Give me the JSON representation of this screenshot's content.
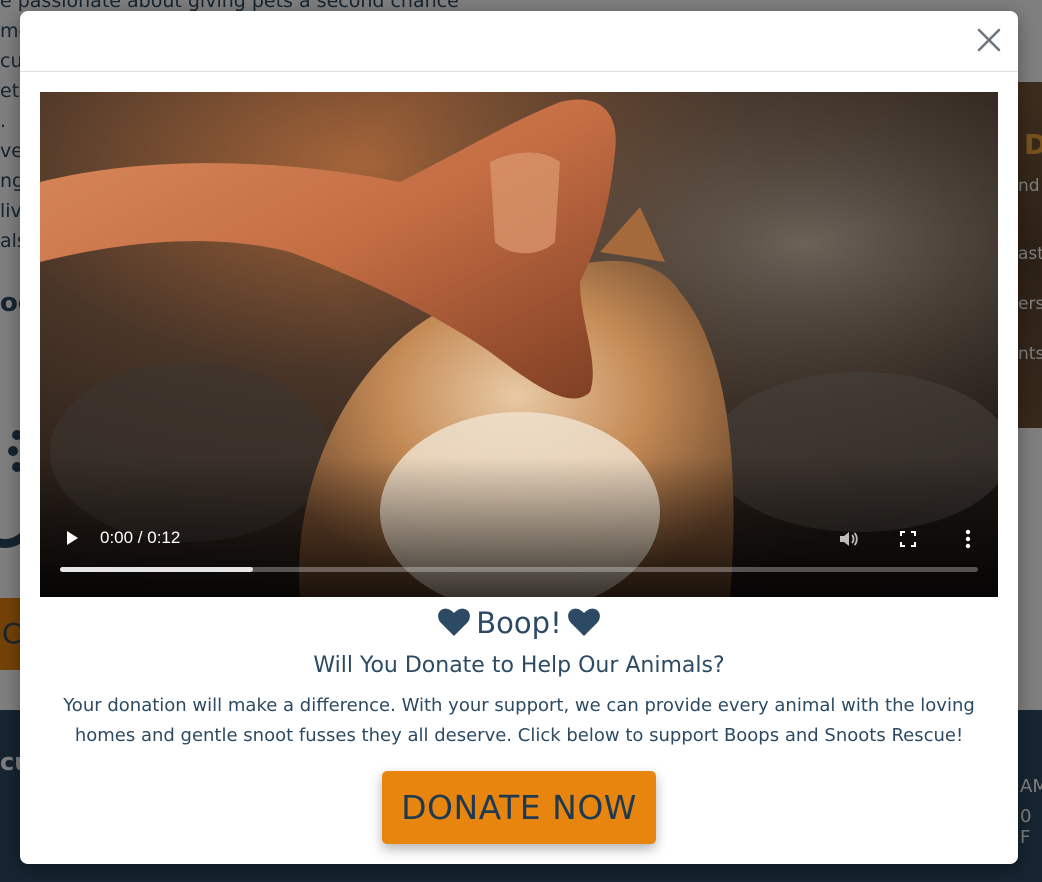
{
  "background": {
    "left_lines": [
      "e passionate about giving pets a second chance",
      "me",
      "cu",
      "et",
      ".",
      "ve",
      "ng",
      "liv",
      "als"
    ],
    "left_heading": "oo",
    "right_title": "D",
    "right_lines": [
      "nd",
      "ast",
      "ers",
      "nts"
    ],
    "orange_button_label": "C",
    "footer_left": "cu",
    "footer_right_lines": [
      "AM",
      "0 F"
    ]
  },
  "modal": {
    "close_icon": "close-icon",
    "video": {
      "time": "0:00 / 0:12",
      "progress": 0.21,
      "icons": [
        "play-icon",
        "volume-icon",
        "fullscreen-icon",
        "more-options-icon"
      ]
    },
    "title": "Boop!",
    "heart_icon": "heart-icon",
    "subtitle": "Will You Donate to Help Our Animals?",
    "body": "Your donation will make a difference. With your support, we can provide every animal with the loving homes and gentle snoot fusses they all deserve. Click below to support Boops and Snoots Rescue!",
    "cta_label": "DONATE NOW"
  },
  "colors": {
    "navy": "#2c4a63",
    "orange": "#e8850f",
    "overlay": "rgba(0,0,0,0.5)"
  }
}
